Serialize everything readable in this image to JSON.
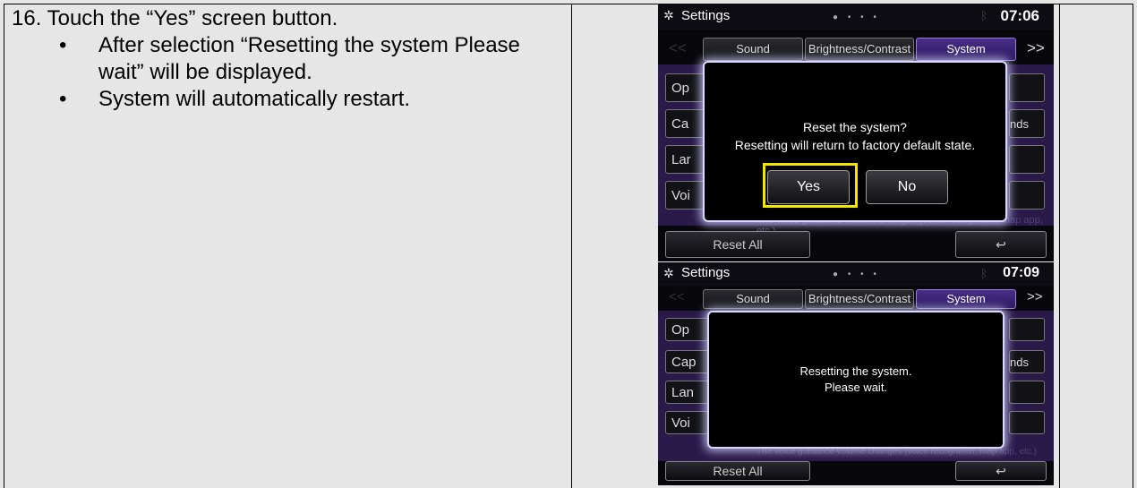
{
  "instruction": {
    "step": "16. Touch the “Yes” screen button.",
    "bullets": [
      "After selection “Resetting the system Please wait” will be displayed.",
      "System will automatically restart."
    ],
    "bullet_char": "•"
  },
  "screen1": {
    "title": "Settings",
    "clock": "07:06",
    "tabs": [
      "Sound",
      "Brightness/Contrast",
      "System"
    ],
    "nav_left": "<<",
    "nav_right": ">>",
    "items": [
      "Op",
      "Ca",
      "Lar",
      "Voi"
    ],
    "right_items": [
      "",
      "nds",
      "",
      ""
    ],
    "footnote": "The voice guidance volume changes (voice recognition, map app, etc.)",
    "reset_label": "Reset All",
    "back_icon": "↩",
    "dialog": {
      "line1": "Reset the system?",
      "line2": "Resetting will return to factory default state.",
      "yes": "Yes",
      "no": "No"
    }
  },
  "screen2": {
    "title": "Settings",
    "clock": "07:09",
    "tabs": [
      "Sound",
      "Brightness/Contrast",
      "System"
    ],
    "nav_left": "<<",
    "nav_right": ">>",
    "items": [
      "Op",
      "Cap",
      "Lan",
      "Voi"
    ],
    "right_items": [
      "",
      "nds",
      "",
      ""
    ],
    "footnote": "The voice guidance volume changes (voice recognition, map app, etc.)",
    "reset_label": "Reset All",
    "back_icon": "↩",
    "dialog": {
      "line1": "Resetting the system.",
      "line2": "Please wait."
    }
  },
  "colors": {
    "highlight": "#f3e600",
    "tab_active": "#4a2f88"
  }
}
